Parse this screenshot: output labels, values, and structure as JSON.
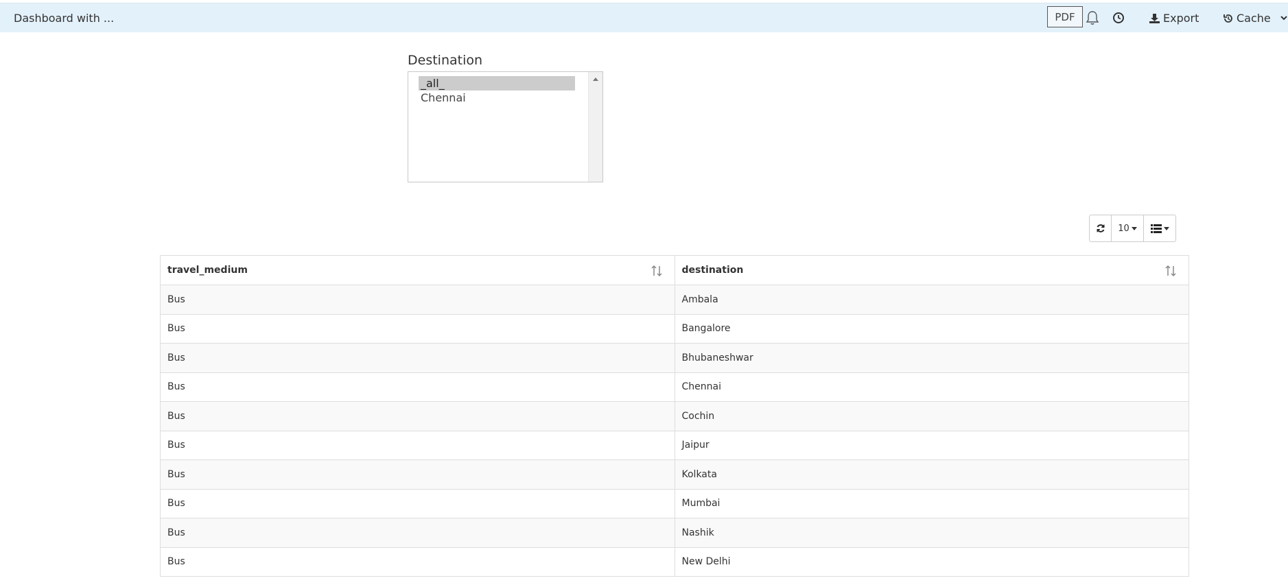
{
  "header": {
    "title": "Dashboard with ...",
    "pdf_label": "PDF",
    "export_label": "Export",
    "cache_label": "Cache"
  },
  "filter": {
    "label": "Destination",
    "options": [
      "_all_",
      "Chennai"
    ],
    "selected": "_all_"
  },
  "table_toolbar": {
    "page_size": "10"
  },
  "table": {
    "columns": [
      "travel_medium",
      "destination"
    ],
    "rows": [
      [
        "Bus",
        "Ambala"
      ],
      [
        "Bus",
        "Bangalore"
      ],
      [
        "Bus",
        "Bhubaneshwar"
      ],
      [
        "Bus",
        "Chennai"
      ],
      [
        "Bus",
        "Cochin"
      ],
      [
        "Bus",
        "Jaipur"
      ],
      [
        "Bus",
        "Kolkata"
      ],
      [
        "Bus",
        "Mumbai"
      ],
      [
        "Bus",
        "Nashik"
      ],
      [
        "Bus",
        "New Delhi"
      ]
    ]
  },
  "colors": {
    "topbar_bg": "#e3f1fa",
    "selected_option_bg": "#cccccc",
    "row_stripe": "#f9f9f9"
  }
}
